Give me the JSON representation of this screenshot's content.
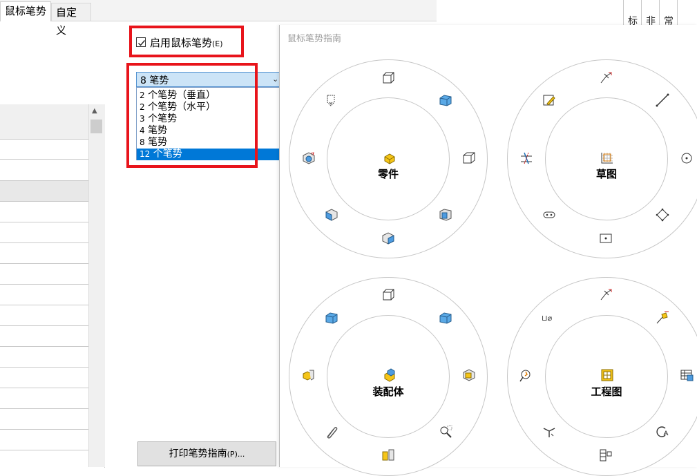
{
  "tabs": [
    {
      "label": "鼠标笔势"
    },
    {
      "label": "自定义"
    }
  ],
  "header_columns": [
    "标",
    "非",
    "常"
  ],
  "checkbox": {
    "label": "启用鼠标笔势",
    "shortcut": "(E)",
    "checked": true
  },
  "dropdown": {
    "selected": "8 笔势",
    "options": [
      {
        "num": "2",
        "label": "个笔势（垂直）"
      },
      {
        "num": "2",
        "label": "个笔势（水平）"
      },
      {
        "num": "3",
        "label": "个笔势"
      },
      {
        "num": "4",
        "label": "笔势"
      },
      {
        "num": "8",
        "label": "笔势"
      },
      {
        "num": "12",
        "label": "个笔势"
      }
    ],
    "highlighted_index": 5
  },
  "print_button": {
    "label": "打印笔势指南",
    "shortcut": "(P)..."
  },
  "guide": {
    "title": "鼠标笔势指南",
    "circles": [
      {
        "name": "零件"
      },
      {
        "name": "草图"
      },
      {
        "name": "装配体"
      },
      {
        "name": "工程图"
      }
    ]
  },
  "colors": {
    "highlight_red": "#e8141b",
    "selection_blue": "#0078d7",
    "combo_bg": "#cce4f7"
  }
}
